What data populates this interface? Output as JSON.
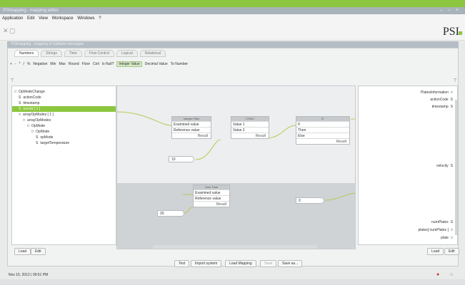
{
  "window": {
    "title": "PSImapping - mapping editor",
    "controls": "– ▫ ×"
  },
  "menu": [
    "Application",
    "Edit",
    "View",
    "Workspace",
    "Windows",
    "?"
  ],
  "brand": {
    "logo": "PSI",
    "accent": "#8cc63f"
  },
  "editor_title": "PSImapping - mapping of OpMode messages",
  "tabs": [
    {
      "label": "Numbers",
      "active": true
    },
    {
      "label": "Strings",
      "active": false
    },
    {
      "label": "Time",
      "active": false
    },
    {
      "label": "Flow Control",
      "active": false
    },
    {
      "label": "Logical",
      "active": false
    },
    {
      "label": "Relational",
      "active": false
    }
  ],
  "functions": [
    "+",
    "-",
    "*",
    "/",
    "%",
    "Negation",
    "Min",
    "Max",
    "Round",
    "Floor",
    "Ceil",
    "Is Null?",
    "Integer Value",
    "Decimal Value",
    "To Number"
  ],
  "functions_selected": "Integer Value",
  "left_tree": [
    {
      "label": "OpModeChange",
      "indent": 0,
      "prefix": "□",
      "selected": false
    },
    {
      "label": "actionCode",
      "indent": 1,
      "prefix": "S",
      "selected": false
    },
    {
      "label": "timestamp",
      "indent": 1,
      "prefix": "S",
      "selected": false
    },
    {
      "label": "recnbr [ 1 ]",
      "indent": 1,
      "prefix": "S",
      "selected": true
    },
    {
      "label": "arrayOpModes [ 1 ]",
      "indent": 1,
      "prefix": "□",
      "selected": false
    },
    {
      "label": "arrayOpModes",
      "indent": 2,
      "prefix": "□",
      "selected": false
    },
    {
      "label": "OpMode",
      "indent": 3,
      "prefix": "□",
      "selected": false
    },
    {
      "label": "OpMode",
      "indent": 4,
      "prefix": "□",
      "selected": false
    },
    {
      "label": "opMode",
      "indent": 5,
      "prefix": "S",
      "selected": false
    },
    {
      "label": "targetTemperature",
      "indent": 5,
      "prefix": "S",
      "selected": false
    }
  ],
  "left_buttons": {
    "load": "Load",
    "edit": "Edit"
  },
  "nodes": {
    "integer_filter": {
      "title": "Integer Filter",
      "rows": [
        "Examined value",
        "Reference value"
      ],
      "result": "Result"
    },
    "concat": {
      "title": "CONC",
      "rows": [
        "Value 1",
        "Value 2"
      ],
      "result": "Result"
    },
    "if_node": {
      "title": "IF",
      "rows": [
        "If",
        "Then",
        "Else"
      ],
      "result": "Result"
    },
    "less_than": {
      "title": "Less Than",
      "rows": [
        "Examined value",
        "Reference value"
      ],
      "result": "Result"
    }
  },
  "constants": {
    "c1": "10",
    "c2": "20",
    "c3": "0"
  },
  "right_tree": [
    {
      "label": "PlatesInformation",
      "prefix": "□"
    },
    {
      "label": "actionCode",
      "prefix": "S"
    },
    {
      "label": "timestamp",
      "prefix": "S"
    },
    {
      "label": "velocity",
      "prefix": "S"
    },
    {
      "label": "numPlates",
      "prefix": "S"
    },
    {
      "label": "plates[ numPlates ]",
      "prefix": "□"
    },
    {
      "label": "plate",
      "prefix": "□"
    }
  ],
  "right_buttons": {
    "load": "Load",
    "edit": "Edit"
  },
  "bottom_buttons": {
    "test": "Test",
    "import": "Import system",
    "load_mapping": "Load Mapping",
    "save": "Save",
    "save_as": "Save as..."
  },
  "status": {
    "datetime": "Nov 15, 2012 | 09:51 PM"
  }
}
